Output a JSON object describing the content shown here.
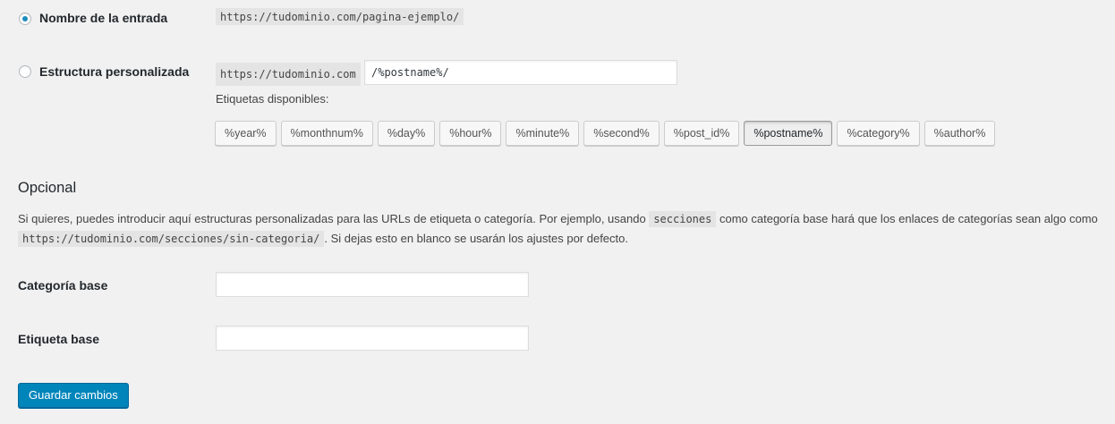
{
  "permalinks": {
    "post_name": {
      "label": "Nombre de la entrada",
      "example": "https://tudominio.com/pagina-ejemplo/",
      "selected": true
    },
    "custom": {
      "label": "Estructura personalizada",
      "prefix": "https://tudominio.com",
      "value": "/%postname%/",
      "selected": false,
      "available_label": "Etiquetas disponibles:",
      "tags": [
        {
          "label": "%year%",
          "active": false
        },
        {
          "label": "%monthnum%",
          "active": false
        },
        {
          "label": "%day%",
          "active": false
        },
        {
          "label": "%hour%",
          "active": false
        },
        {
          "label": "%minute%",
          "active": false
        },
        {
          "label": "%second%",
          "active": false
        },
        {
          "label": "%post_id%",
          "active": false
        },
        {
          "label": "%postname%",
          "active": true
        },
        {
          "label": "%category%",
          "active": false
        },
        {
          "label": "%author%",
          "active": false
        }
      ]
    }
  },
  "optional": {
    "heading": "Opcional",
    "desc_part1": "Si quieres, puedes introducir aquí estructuras personalizadas para las URLs de etiqueta o categoría. Por ejemplo, usando",
    "desc_code1": "secciones",
    "desc_part2": "como categoría base hará que los enlaces de categorías sean algo como",
    "desc_code2": "https://tudominio.com/secciones/sin-categoria/",
    "desc_part3": ". Si dejas esto en blanco se usarán los ajustes por defecto.",
    "category_base_label": "Categoría base",
    "category_base_value": "",
    "tag_base_label": "Etiqueta base",
    "tag_base_value": ""
  },
  "save_button_label": "Guardar cambios",
  "colors": {
    "background": "#f1f1f1",
    "primary_button": "#0085ba",
    "radio_dot": "#1e8cbe"
  }
}
